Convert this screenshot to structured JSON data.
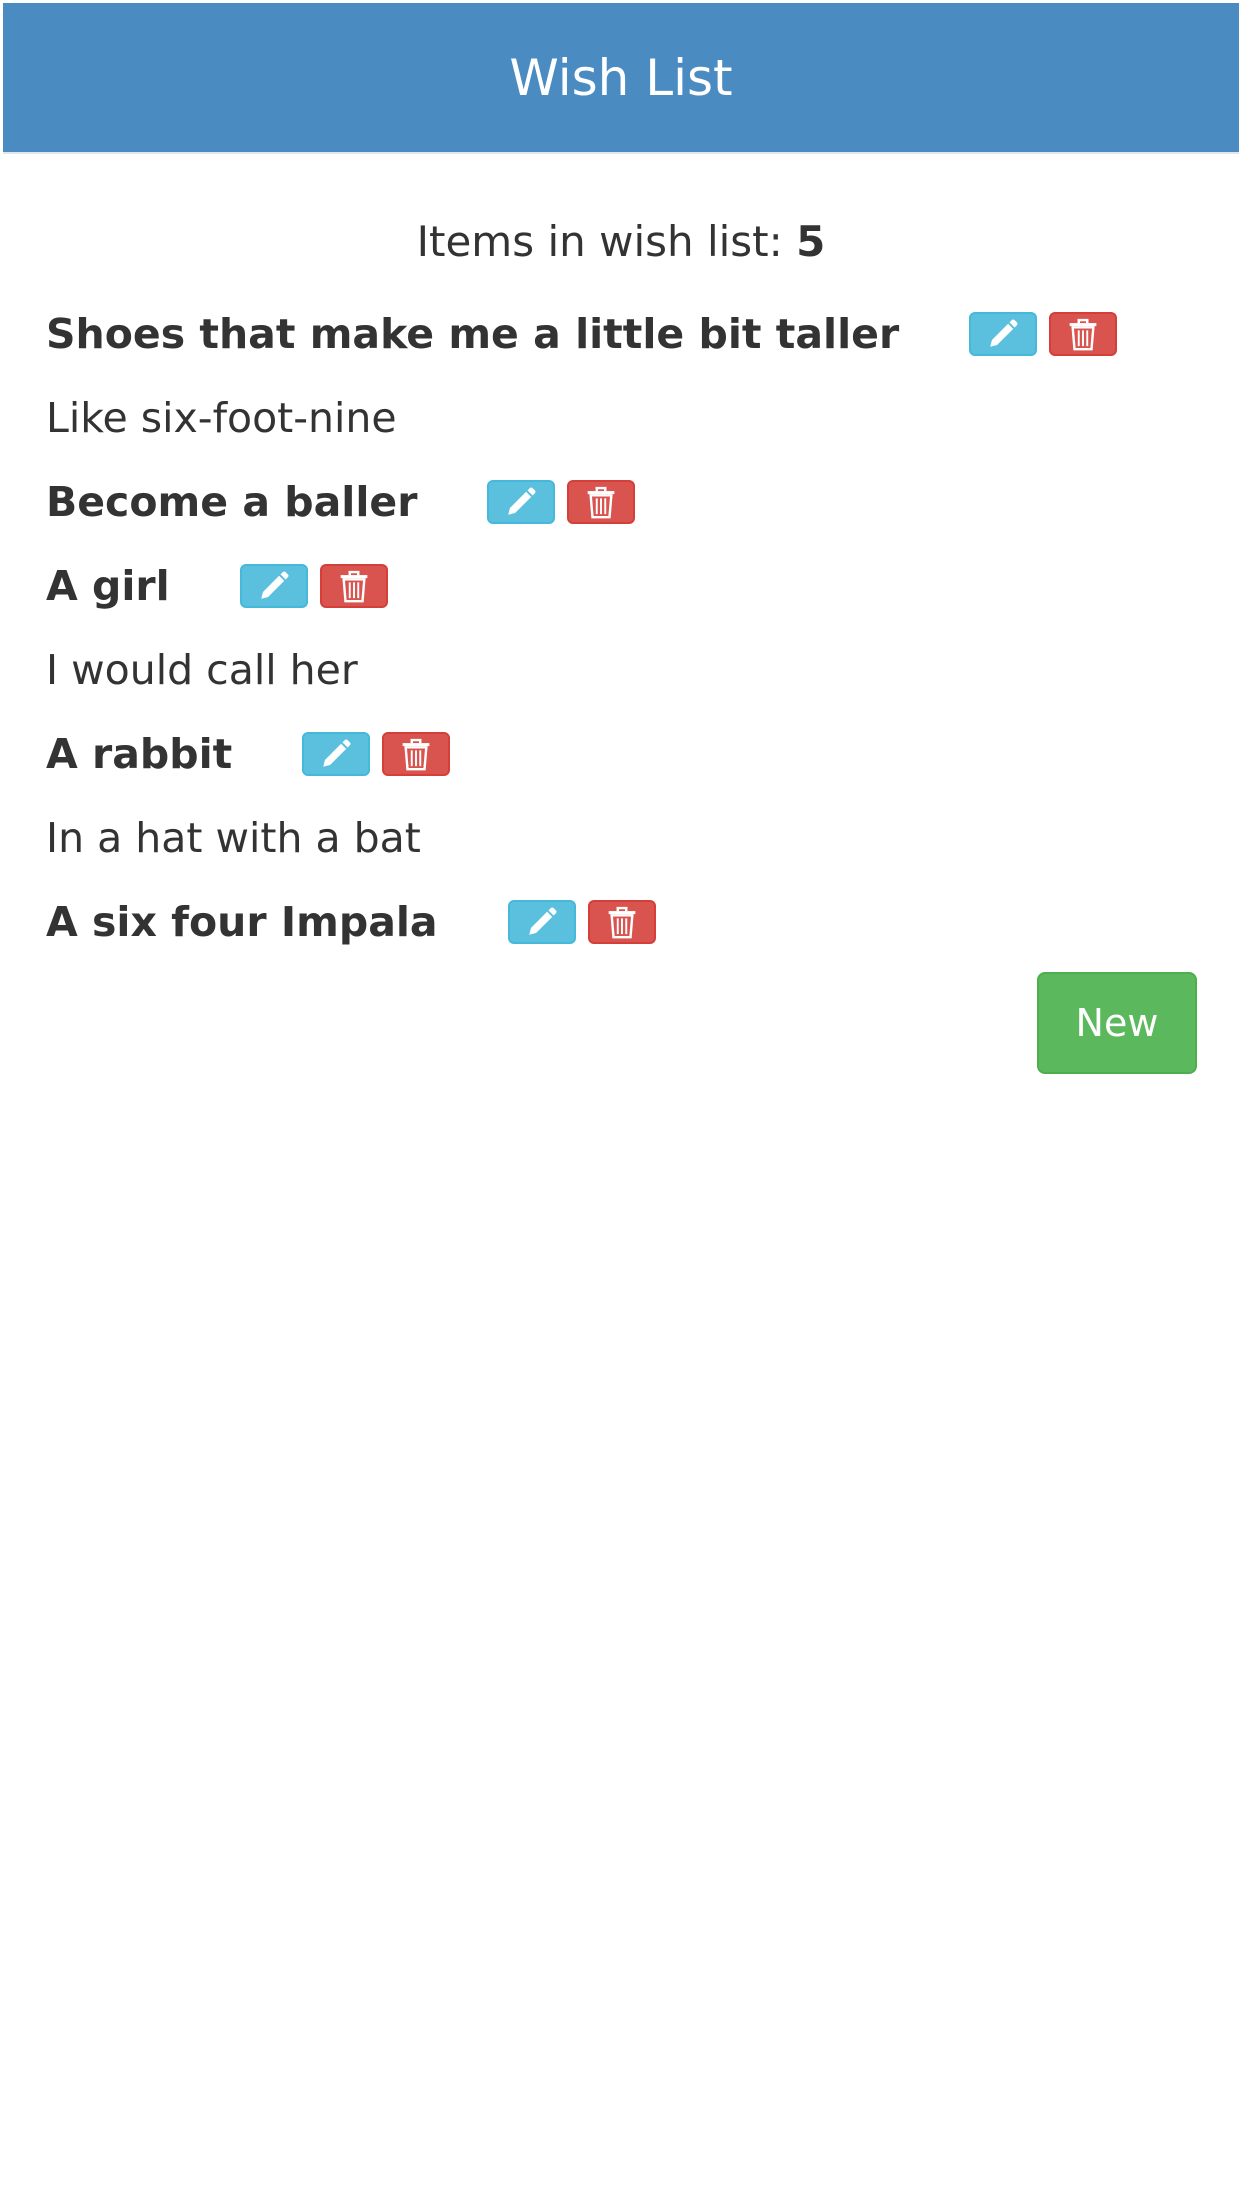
{
  "header": {
    "title": "Wish List"
  },
  "summary": {
    "label": "Items in wish list:",
    "count": "5"
  },
  "items": [
    {
      "title": "Shoes that make me a little bit taller",
      "description": "Like six-foot-nine"
    },
    {
      "title": "Become a baller",
      "description": ""
    },
    {
      "title": "A girl",
      "description": "I would call her"
    },
    {
      "title": "A rabbit",
      "description": "In a hat with a bat"
    },
    {
      "title": "A six four Impala",
      "description": ""
    }
  ],
  "actions": {
    "new_label": "New",
    "edit_icon": "pencil-icon",
    "delete_icon": "trash-icon"
  },
  "colors": {
    "header": "#4a8bc2",
    "edit": "#5bc0de",
    "delete": "#d9534f",
    "new": "#5cb85c"
  }
}
